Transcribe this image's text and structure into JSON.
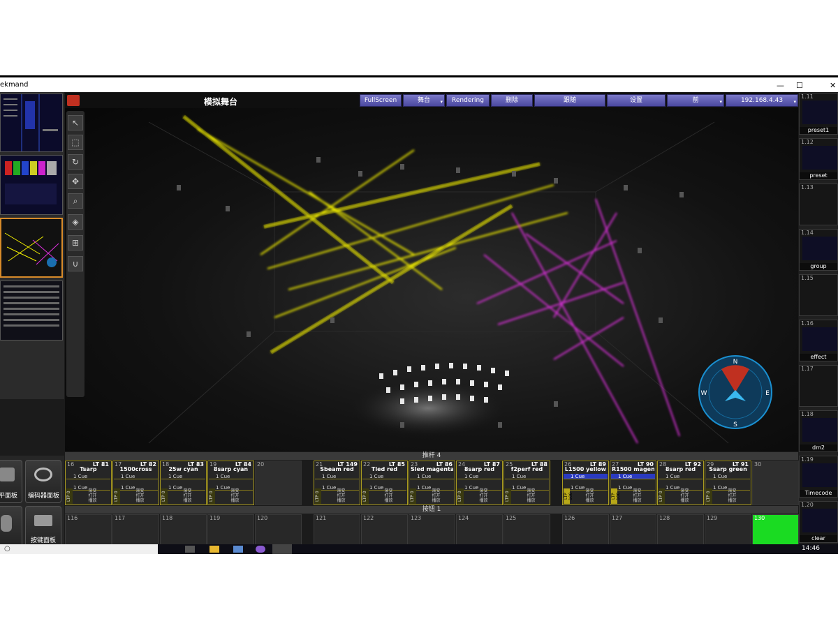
{
  "window": {
    "title": "ekmand",
    "controls": [
      "—",
      "☐",
      "✕"
    ]
  },
  "stage": {
    "title": "模拟舞台",
    "toolbar_buttons": [
      "FullScreen",
      "舞台",
      "Rendering",
      "删除",
      "跟随",
      "设置",
      "前",
      "192.168.4.43"
    ]
  },
  "left_panel": {
    "buttons": [
      {
        "label": "平面板"
      },
      {
        "label": "编码器面板"
      },
      {
        "label": "按键面板"
      }
    ]
  },
  "fader_bar": {
    "label": "推杆 4"
  },
  "button_bar": {
    "label": "按钮 1"
  },
  "playbacks": [
    {
      "num": "16",
      "lt": "LT 81",
      "name": "Tsarp",
      "cue1": "1 Cue",
      "cue2": "1 Cue",
      "ltp": "LTP 0",
      "active": false
    },
    {
      "num": "17",
      "lt": "LT 82",
      "name": "1500cross",
      "cue1": "1 Cue",
      "cue2": "1 Cue",
      "ltp": "LTP 0",
      "active": false
    },
    {
      "num": "18",
      "lt": "LT 83",
      "name": "25w cyan",
      "cue1": "1 Cue",
      "cue2": "1 Cue",
      "ltp": "LTP 0",
      "active": false
    },
    {
      "num": "19",
      "lt": "LT 84",
      "name": "8sarp cyan",
      "cue1": "1 Cue",
      "cue2": "1 Cue",
      "ltp": "LTP 0",
      "active": false
    },
    {
      "num": "21",
      "lt": "LT 149",
      "name": "Sbeam red",
      "cue1": "1 Cue",
      "cue2": "1 Cue",
      "ltp": "LTP 0",
      "active": false
    },
    {
      "num": "22",
      "lt": "LT 85",
      "name": "Tled red",
      "cue1": "1 Cue",
      "cue2": "1 Cue",
      "ltp": "LTP 0",
      "active": false
    },
    {
      "num": "23",
      "lt": "LT 86",
      "name": "Sled magenta",
      "cue1": "1 Cue",
      "cue2": "1 Cue",
      "ltp": "LTP 0",
      "active": false
    },
    {
      "num": "24",
      "lt": "LT 87",
      "name": "8sarp red",
      "cue1": "1 Cue",
      "cue2": "1 Cue",
      "ltp": "LTP 0",
      "active": false
    },
    {
      "num": "25",
      "lt": "LT 88",
      "name": "f2perf red",
      "cue1": "1 Cue",
      "cue2": "1 Cue",
      "ltp": "LTP 0",
      "active": false
    },
    {
      "num": "26",
      "lt": "LT 89",
      "name": "L1500 yellow",
      "cue1": "1 Cue",
      "cue2": "1 Cue",
      "ltp": "LTP 100",
      "active": true
    },
    {
      "num": "27",
      "lt": "LT 90",
      "name": "R1500 magent",
      "cue1": "1 Cue",
      "cue2": "1 Cue",
      "ltp": "LTP 100",
      "active": true
    },
    {
      "num": "28",
      "lt": "LT 92",
      "name": "8sarp red",
      "cue1": "1 Cue",
      "cue2": "1 Cue",
      "ltp": "LTP 0",
      "active": false
    },
    {
      "num": "29",
      "lt": "LT 91",
      "name": "Ssarp green",
      "cue1": "1 Cue",
      "cue2": "1 Cue",
      "ltp": "LTP 0",
      "active": false
    }
  ],
  "empty_playbacks": [
    "20",
    "30"
  ],
  "cell_controls": {
    "c1": "渐变",
    "c2": "打开",
    "c3": "播放"
  },
  "buttons": [
    "116",
    "117",
    "118",
    "119",
    "120",
    "121",
    "122",
    "123",
    "124",
    "125",
    "126",
    "127",
    "128",
    "129",
    "130"
  ],
  "right_views": [
    {
      "num": "1.11",
      "label": "preset1"
    },
    {
      "num": "1.12",
      "label": "preset"
    },
    {
      "num": "1.13",
      "label": ""
    },
    {
      "num": "1.14",
      "label": "group"
    },
    {
      "num": "1.15",
      "label": ""
    },
    {
      "num": "1.16",
      "label": "effect"
    },
    {
      "num": "1.17",
      "label": ""
    },
    {
      "num": "1.18",
      "label": "dm2"
    },
    {
      "num": "1.19",
      "label": "Timecode"
    },
    {
      "num": "1.20",
      "label": "clear"
    }
  ],
  "compass": {
    "n": "N",
    "s": "S",
    "e": "E",
    "w": "W"
  },
  "taskbar": {
    "time": "14:46"
  },
  "colors": {
    "beam_yellow": "#f4f000",
    "beam_magenta": "#e030e0",
    "button_purple": "#5e5bb8",
    "active_green": "#1adb22",
    "compass_blue": "#1a8fd0"
  }
}
